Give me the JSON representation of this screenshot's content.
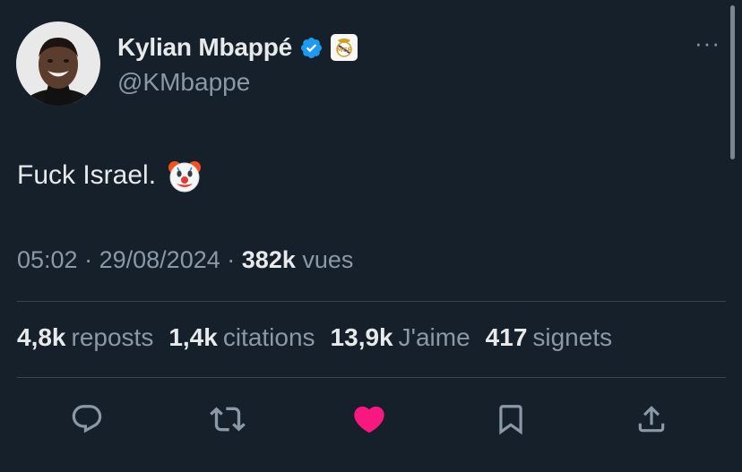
{
  "header": {
    "display_name": "Kylian Mbappé",
    "handle": "@KMbappe",
    "avatar_icon": "profile-photo",
    "verified_icon": "verified-badge-icon",
    "affiliate_icon": "real-madrid-crest-icon",
    "more_icon": "more-horizontal-icon",
    "more_label": "···"
  },
  "tweet": {
    "text": "Fuck Israel.",
    "emoji": "clown-face-emoji",
    "time": "05:02",
    "date": "29/08/2024",
    "separator": "·",
    "views_count": "382k",
    "views_label": "vues"
  },
  "stats": [
    {
      "count": "4,8k",
      "label": "reposts"
    },
    {
      "count": "1,4k",
      "label": "citations"
    },
    {
      "count": "13,9k",
      "label": "J'aime"
    },
    {
      "count": "417",
      "label": "signets"
    }
  ],
  "actions": [
    {
      "name": "reply-icon",
      "active": false
    },
    {
      "name": "repost-icon",
      "active": false
    },
    {
      "name": "like-icon",
      "active": true
    },
    {
      "name": "bookmark-icon",
      "active": false
    },
    {
      "name": "share-icon",
      "active": false
    }
  ],
  "colors": {
    "background": "#15202b",
    "text": "#e7e9ea",
    "secondary": "#8b98a5",
    "verified": "#1d9bf0",
    "like": "#f91880",
    "divider": "#38444d"
  }
}
